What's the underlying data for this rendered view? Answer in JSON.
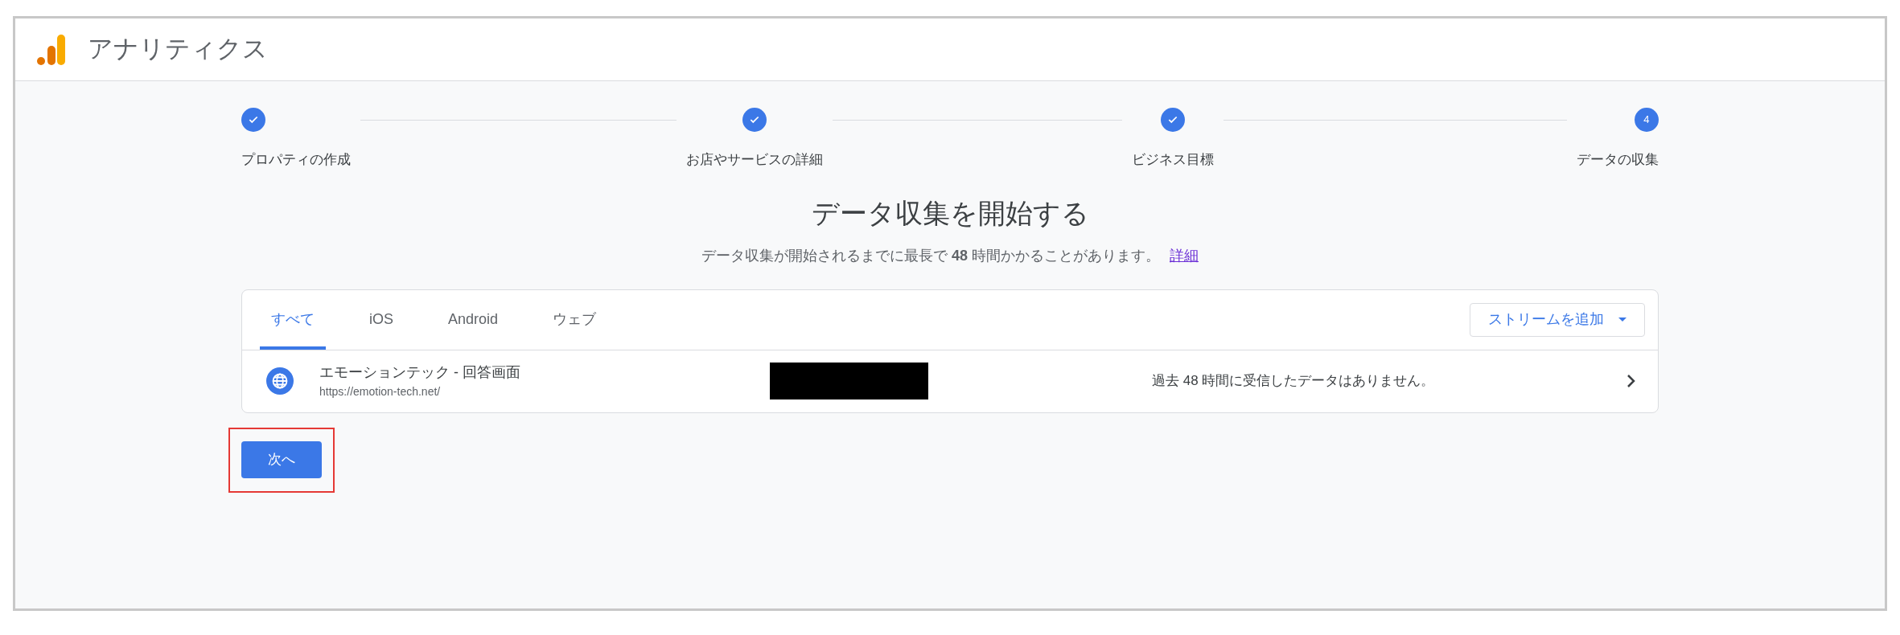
{
  "header": {
    "title": "アナリティクス"
  },
  "steps": [
    {
      "label": "プロパティの作成",
      "done": true
    },
    {
      "label": "お店やサービスの詳細",
      "done": true
    },
    {
      "label": "ビジネス目標",
      "done": true
    },
    {
      "label": "データの収集",
      "done": false,
      "number": "4"
    }
  ],
  "heading": "データ収集を開始する",
  "subtitle": "データ収集が開始されるまでに最長で **48** 時間かかることがあります。",
  "subtitle_link": "詳細",
  "tabs": [
    {
      "label": "すべて",
      "selected": true
    },
    {
      "label": "iOS",
      "selected": false
    },
    {
      "label": "Android",
      "selected": false
    },
    {
      "label": "ウェブ",
      "selected": false
    }
  ],
  "add_stream_button": "ストリームを追加",
  "streams": [
    {
      "name": "エモーションテック - 回答画面",
      "url": "https://emotion-tech.net/",
      "redacted": true,
      "status": "過去 48 時間に受信したデータはありません。"
    }
  ],
  "next_button": {
    "label": "次へ",
    "highlighted": true
  }
}
